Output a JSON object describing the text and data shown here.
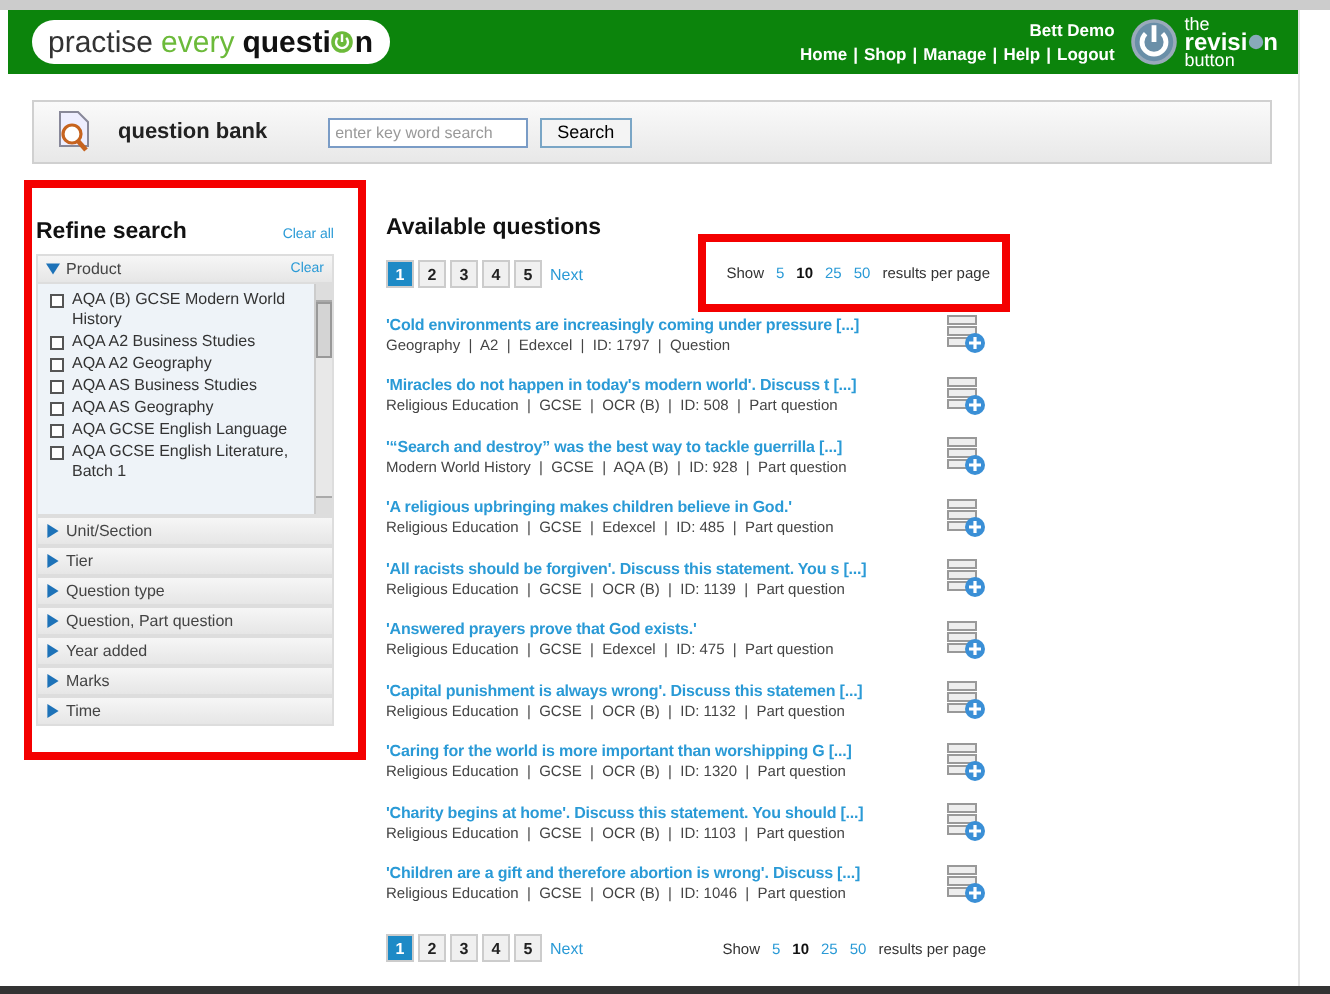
{
  "header": {
    "logo": [
      "practise",
      "every",
      "questi",
      "n"
    ],
    "user": "Bett Demo",
    "nav": [
      "Home",
      "Shop",
      "Manage",
      "Help",
      "Logout"
    ],
    "nav_separator": "|",
    "brand": [
      "the",
      "revisi",
      "n",
      "button"
    ]
  },
  "search_bar": {
    "title": "question bank",
    "placeholder": "enter key word search",
    "button": "Search"
  },
  "sidebar": {
    "highlighted": true,
    "title": "Refine search",
    "clear_all": "Clear all",
    "facets": [
      {
        "label": "Product",
        "expanded": true,
        "clear": "Clear",
        "options": [
          {
            "label": "AQA (B) GCSE Modern World History",
            "checked": false
          },
          {
            "label": "AQA A2 Business Studies",
            "checked": false
          },
          {
            "label": "AQA A2 Geography",
            "checked": false
          },
          {
            "label": "AQA AS Business Studies",
            "checked": false
          },
          {
            "label": "AQA AS Geography",
            "checked": false
          },
          {
            "label": "AQA GCSE English Language",
            "checked": false
          },
          {
            "label": "AQA GCSE English Literature, Batch 1",
            "checked": false
          }
        ]
      },
      {
        "label": "Unit/Section",
        "expanded": false
      },
      {
        "label": "Tier",
        "expanded": false
      },
      {
        "label": "Question type",
        "expanded": false
      },
      {
        "label": "Question, Part question",
        "expanded": false
      },
      {
        "label": "Year added",
        "expanded": false
      },
      {
        "label": "Marks",
        "expanded": false
      },
      {
        "label": "Time",
        "expanded": false
      }
    ]
  },
  "main": {
    "title": "Available questions",
    "pagination_top": {
      "pages": [
        {
          "label": "1",
          "selected": true
        },
        {
          "label": "2",
          "selected": false
        },
        {
          "label": "3",
          "selected": false
        },
        {
          "label": "4",
          "selected": false
        },
        {
          "label": "5",
          "selected": false
        }
      ],
      "next": "Next",
      "per_page": {
        "highlighted": true,
        "show": "Show",
        "options": [
          {
            "label": "5",
            "selected": false
          },
          {
            "label": "10",
            "selected": true
          },
          {
            "label": "25",
            "selected": false
          },
          {
            "label": "50",
            "selected": false
          }
        ],
        "suffix": "results per page"
      }
    },
    "questions": [
      {
        "title": "'Cold environments are increasingly coming under pressure [...]",
        "meta": "Geography  |  A2  |  Edexcel  |  ID: 1797  |  Question"
      },
      {
        "title": "'Miracles do not happen in today's modern world'. Discuss t [...]",
        "meta": "Religious Education  |  GCSE  |  OCR (B)  |  ID: 508  |  Part question"
      },
      {
        "title": "'“Search and destroy” was the best way to tackle guerrilla [...]",
        "meta": "Modern World History  |  GCSE  |  AQA (B)  |  ID: 928  |  Part question"
      },
      {
        "title": "'A religious upbringing makes children believe in God.'",
        "meta": "Religious Education  |  GCSE  |  Edexcel  |  ID: 485  |  Part question"
      },
      {
        "title": "'All racists should be forgiven'. Discuss this statement. You s [...]",
        "meta": "Religious Education  |  GCSE  |  OCR (B)  |  ID: 1139  |  Part question"
      },
      {
        "title": "'Answered prayers prove that God exists.'",
        "meta": "Religious Education  |  GCSE  |  Edexcel  |  ID: 475  |  Part question"
      },
      {
        "title": "'Capital punishment is always wrong'. Discuss this statemen [...]",
        "meta": "Religious Education  |  GCSE  |  OCR (B)  |  ID: 1132  |  Part question"
      },
      {
        "title": "'Caring for the world is more important than worshipping G [...]",
        "meta": "Religious Education  |  GCSE  |  OCR (B)  |  ID: 1320  |  Part question"
      },
      {
        "title": "'Charity begins at home'. Discuss this statement. You should [...]",
        "meta": "Religious Education  |  GCSE  |  OCR (B)  |  ID: 1103  |  Part question"
      },
      {
        "title": "'Children are a gift and therefore abortion is wrong'. Discuss [...]",
        "meta": "Religious Education  |  GCSE  |  OCR (B)  |  ID: 1046  |  Part question"
      }
    ],
    "pagination_bottom": {
      "pages": [
        {
          "label": "1",
          "selected": true
        },
        {
          "label": "2",
          "selected": false
        },
        {
          "label": "3",
          "selected": false
        },
        {
          "label": "4",
          "selected": false
        },
        {
          "label": "5",
          "selected": false
        }
      ],
      "next": "Next",
      "per_page": {
        "show": "Show",
        "options": [
          {
            "label": "5",
            "selected": false
          },
          {
            "label": "10",
            "selected": true
          },
          {
            "label": "25",
            "selected": false
          },
          {
            "label": "50",
            "selected": false
          }
        ],
        "suffix": "results per page"
      }
    }
  }
}
